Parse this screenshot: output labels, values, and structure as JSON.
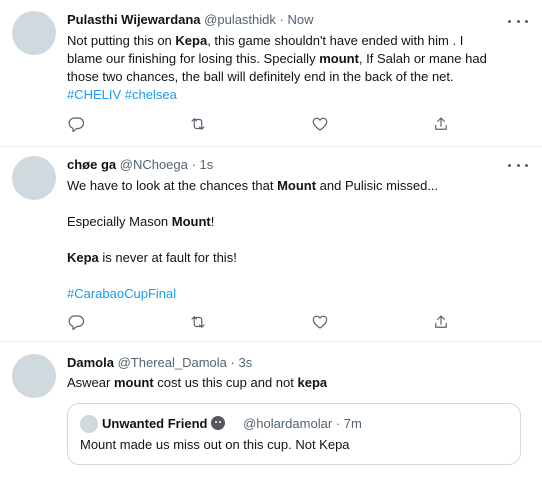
{
  "tweets": [
    {
      "author": "Pulasthi Wijewardana",
      "handle": "@pulasthidk",
      "sep": "·",
      "time": "Now",
      "text_lines": [
        [
          "Not putting this on ",
          "Kepa",
          ",  this game shouldn't have ended with him .  I"
        ],
        [
          "blame our finishing for losing this. Specially ",
          "mount",
          ",  If Salah or mane had"
        ],
        [
          "those two chances, the ball will definitely end in the back of the net."
        ]
      ],
      "hashtags": "#CHELIV #chelsea"
    },
    {
      "author": "chøe ga",
      "handle": "@NChoega",
      "sep": "·",
      "time": "1s",
      "para1": [
        "We have to look at the chances that ",
        "Mount",
        " and Pulisic missed..."
      ],
      "para2": [
        "Especially Mason ",
        "Mount",
        "!"
      ],
      "para3": [
        "Kepa",
        " is never at fault for this!"
      ],
      "hashtags": "#CarabaoCupFinal"
    },
    {
      "author": "Damola",
      "handle": "@Thereal_Damola",
      "sep": "·",
      "time": "3s",
      "text": [
        "Aswear ",
        "mount",
        " cost us this cup and not ",
        "kepa"
      ],
      "quote": {
        "author": "Unwanted Friend",
        "emoji": "pensive-face",
        "handle": "@holardamolar",
        "sep": "·",
        "time": "7m",
        "text": "Mount made us miss out on this cup. Not Kepa"
      }
    }
  ],
  "icons": {
    "reply": "reply-icon",
    "retweet": "retweet-icon",
    "like": "heart-icon",
    "share": "share-icon",
    "more": "more-icon"
  }
}
